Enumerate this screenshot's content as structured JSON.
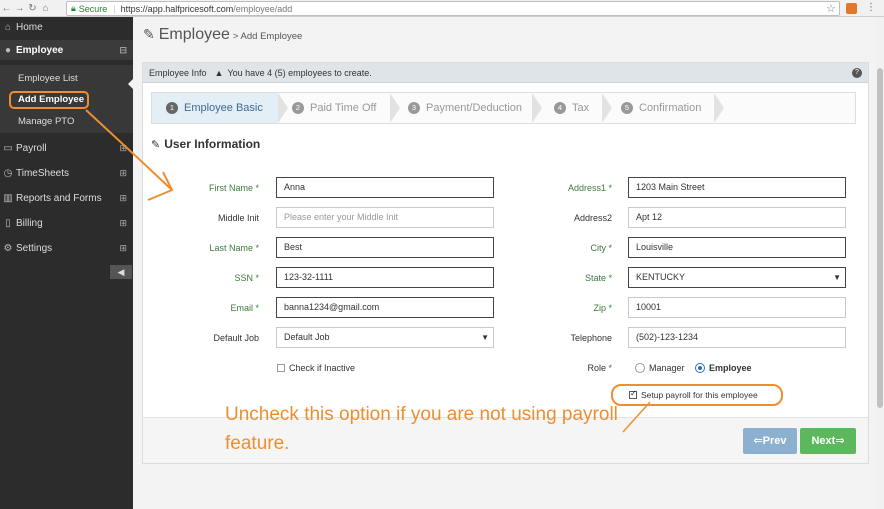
{
  "browser": {
    "secure_label": "Secure",
    "url_host": "https://app.halfpricesoft.com",
    "url_path": "/employee/add"
  },
  "sidebar": {
    "items": [
      {
        "label": "Home"
      },
      {
        "label": "Employee"
      },
      {
        "label": "Payroll"
      },
      {
        "label": "TimeSheets"
      },
      {
        "label": "Reports and Forms"
      },
      {
        "label": "Billing"
      },
      {
        "label": "Settings"
      }
    ],
    "sub_items": [
      {
        "label": "Employee List"
      },
      {
        "label": "Add Employee"
      },
      {
        "label": "Manage PTO"
      }
    ]
  },
  "page": {
    "title": "Employee",
    "breadcrumb": "> Add Employee"
  },
  "info_bar": {
    "label": "Employee Info",
    "message": "You have 4 (5) employees to create."
  },
  "wizard": {
    "steps": [
      {
        "num": "1",
        "label": "Employee Basic"
      },
      {
        "num": "2",
        "label": "Paid Time Off"
      },
      {
        "num": "3",
        "label": "Payment/Deduction"
      },
      {
        "num": "4",
        "label": "Tax"
      },
      {
        "num": "5",
        "label": "Confirmation"
      }
    ]
  },
  "section_title": "User Information",
  "form": {
    "first_name": {
      "label": "First Name",
      "value": "Anna"
    },
    "middle_init": {
      "label": "Middle Init",
      "placeholder": "Please enter your Middle Init"
    },
    "last_name": {
      "label": "Last Name",
      "value": "Best"
    },
    "ssn": {
      "label": "SSN",
      "value": "123-32-1111"
    },
    "email": {
      "label": "Email",
      "value": "banna1234@gmail.com"
    },
    "default_job": {
      "label": "Default Job",
      "value": "Default Job"
    },
    "inactive": {
      "label": "Check if Inactive"
    },
    "address1": {
      "label": "Address1",
      "value": "1203 Main Street"
    },
    "address2": {
      "label": "Address2",
      "value": "Apt 12"
    },
    "city": {
      "label": "City",
      "value": "Louisville"
    },
    "state": {
      "label": "State",
      "value": "KENTUCKY"
    },
    "zip": {
      "label": "Zip",
      "value": "10001"
    },
    "telephone": {
      "label": "Telephone",
      "value": "(502)-123-1234"
    },
    "role": {
      "label": "Role",
      "options": [
        "Manager",
        "Employee"
      ]
    },
    "setup_payroll": {
      "label": "Setup payroll for this employee"
    }
  },
  "required_mark": "*",
  "buttons": {
    "prev": "Prev",
    "next": "Next"
  },
  "annotation": "Uncheck this option if you are not using payroll feature.",
  "colors": {
    "accent": "#ef8e2f",
    "sidebar": "#2c2c2c",
    "next": "#5db75d",
    "prev": "#8cb0d0"
  }
}
